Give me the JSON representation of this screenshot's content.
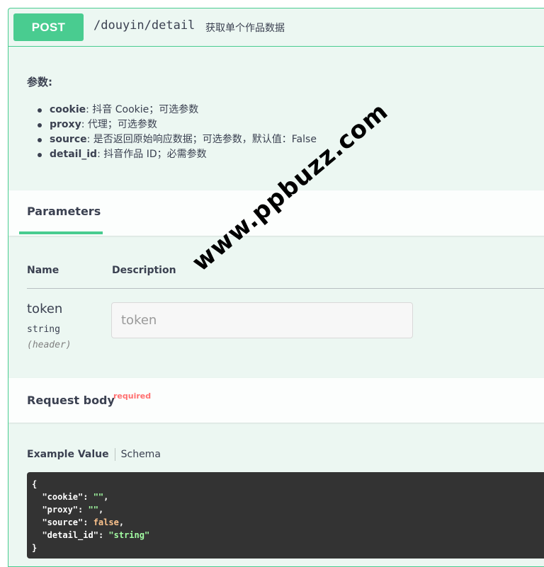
{
  "summary": {
    "method": "POST",
    "path": "/douyin/detail",
    "description": "获取单个作品数据"
  },
  "description_block": {
    "title": "参数:",
    "params": [
      {
        "name": "cookie",
        "text": ": 抖音 Cookie；可选参数"
      },
      {
        "name": "proxy",
        "text": ": 代理；可选参数"
      },
      {
        "name": "source",
        "text": ": 是否返回原始响应数据；可选参数，默认值：False"
      },
      {
        "name": "detail_id",
        "text": ": 抖音作品 ID；必需参数"
      }
    ]
  },
  "parameters": {
    "tab_label": "Parameters",
    "col_name": "Name",
    "col_description": "Description",
    "rows": [
      {
        "name": "token",
        "type": "string",
        "in": "(header)",
        "placeholder": "token",
        "value": ""
      }
    ]
  },
  "request_body": {
    "title": "Request body",
    "required_label": "required",
    "example_tab": "Example Value",
    "schema_tab": "Schema",
    "example": {
      "open": "{",
      "close": "}",
      "fields": [
        {
          "key": "\"cookie\"",
          "value": "\"\"",
          "comma": ","
        },
        {
          "key": "\"proxy\"",
          "value": "\"\"",
          "comma": ","
        },
        {
          "key": "\"source\"",
          "value": "false",
          "comma": ","
        },
        {
          "key": "\"detail_id\"",
          "value": "\"string\"",
          "comma": ""
        }
      ]
    }
  },
  "watermark": "www.ppbuzz.com",
  "colors": {
    "accent": "#49cc90",
    "block_background": "#ecf7f2",
    "required": "#ff6f6f",
    "code_background": "#333333",
    "code_string": "#a2fca2",
    "code_boolean": "#fcc28c"
  }
}
